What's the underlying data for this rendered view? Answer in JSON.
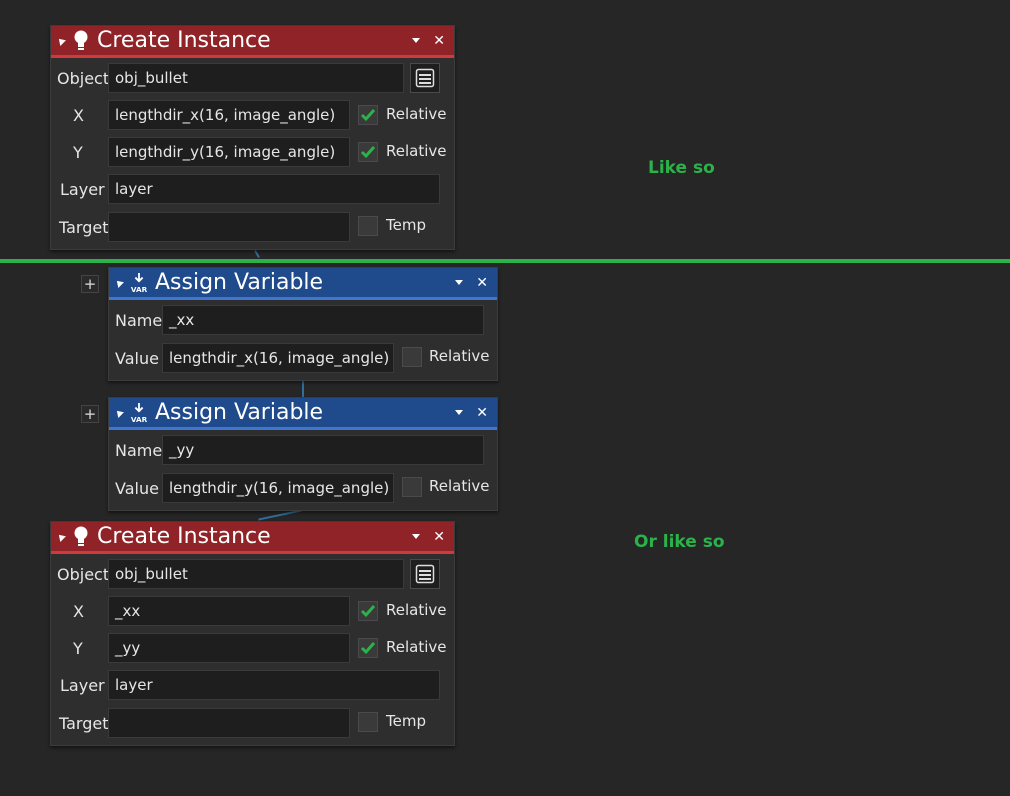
{
  "notes": {
    "first": "Like so",
    "second": "Or like so"
  },
  "colors": {
    "accent_green": "#2bb34a",
    "create_header": "#8f2327",
    "assign_header": "#1f4a8c"
  },
  "create1": {
    "title": "Create Instance",
    "icon": "lightbulb-icon",
    "labels": {
      "object": "Object",
      "x": "X",
      "y": "Y",
      "layer": "Layer",
      "target": "Target"
    },
    "object_value": "obj_bullet",
    "x_value": "lengthdir_x(16, image_angle)",
    "x_relative_label": "Relative",
    "x_relative_checked": true,
    "y_value": "lengthdir_y(16, image_angle)",
    "y_relative_label": "Relative",
    "y_relative_checked": true,
    "layer_value": "layer",
    "target_value": "",
    "temp_label": "Temp",
    "temp_checked": false
  },
  "assign1": {
    "title": "Assign Variable",
    "icon": "var-icon",
    "icon_text": "VAR",
    "labels": {
      "name": "Name",
      "value": "Value"
    },
    "name_value": "_xx",
    "value_value": "lengthdir_x(16, image_angle)",
    "relative_label": "Relative",
    "relative_checked": false,
    "plus_label": "+"
  },
  "assign2": {
    "title": "Assign Variable",
    "icon": "var-icon",
    "icon_text": "VAR",
    "labels": {
      "name": "Name",
      "value": "Value"
    },
    "name_value": "_yy",
    "value_value": "lengthdir_y(16, image_angle)",
    "relative_label": "Relative",
    "relative_checked": false,
    "plus_label": "+"
  },
  "create2": {
    "title": "Create Instance",
    "icon": "lightbulb-icon",
    "labels": {
      "object": "Object",
      "x": "X",
      "y": "Y",
      "layer": "Layer",
      "target": "Target"
    },
    "object_value": "obj_bullet",
    "x_value": "_xx",
    "x_relative_label": "Relative",
    "x_relative_checked": true,
    "y_value": "_yy",
    "y_relative_label": "Relative",
    "y_relative_checked": true,
    "layer_value": "layer",
    "target_value": "",
    "temp_label": "Temp",
    "temp_checked": false
  }
}
